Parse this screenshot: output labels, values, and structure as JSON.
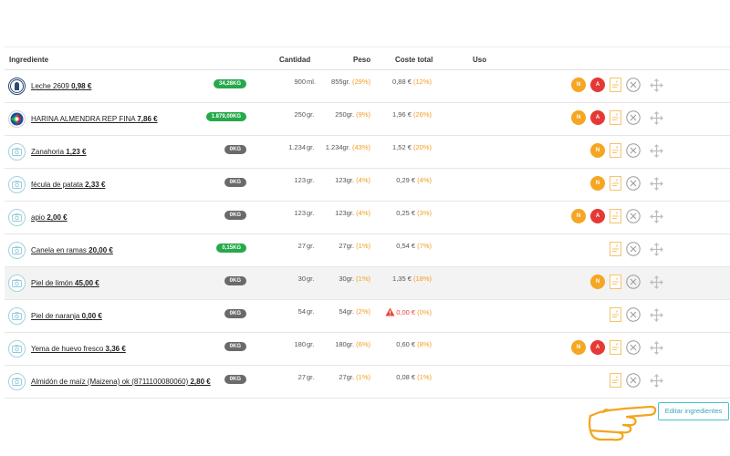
{
  "headers": {
    "ingrediente": "Ingrediente",
    "cantidad": "Cantidad",
    "peso": "Peso",
    "coste_total": "Coste total",
    "uso": "Uso"
  },
  "rows": [
    {
      "name": "Leche 2609",
      "price": "0,98 €",
      "badge": "34,28KG",
      "badge_color": "green",
      "qty": "900",
      "unit": "ml.",
      "peso": "855gr.",
      "peso_pct": "(29%)",
      "coste": "0,88 €",
      "coste_pct": "(12%)",
      "avatar": "logo",
      "flags": [
        "N",
        "A"
      ],
      "highlight": false,
      "warning": false
    },
    {
      "name": "HARINA ALMENDRA REP FINA",
      "price": "7,86 €",
      "badge": "1.879,00KG",
      "badge_color": "green",
      "qty": "250",
      "unit": "gr.",
      "peso": "250gr.",
      "peso_pct": "(9%)",
      "coste": "1,96 €",
      "coste_pct": "(26%)",
      "avatar": "logo",
      "flags": [
        "N",
        "A"
      ],
      "highlight": false,
      "warning": false
    },
    {
      "name": "Zanahoria",
      "price": "1,23 €",
      "badge": "0KG",
      "badge_color": "grey",
      "qty": "1.234",
      "unit": "gr.",
      "peso": "1.234gr.",
      "peso_pct": "(43%)",
      "coste": "1,52 €",
      "coste_pct": "(20%)",
      "avatar": "camera",
      "flags": [
        "N"
      ],
      "highlight": false,
      "warning": false
    },
    {
      "name": "fécula de patata",
      "price": "2,33 €",
      "badge": "0KG",
      "badge_color": "grey",
      "qty": "123",
      "unit": "gr.",
      "peso": "123gr.",
      "peso_pct": "(4%)",
      "coste": "0,29 €",
      "coste_pct": "(4%)",
      "avatar": "camera",
      "flags": [
        "N"
      ],
      "highlight": false,
      "warning": false
    },
    {
      "name": "apio",
      "price": "2,00 €",
      "badge": "0KG",
      "badge_color": "grey",
      "qty": "123",
      "unit": "gr.",
      "peso": "123gr.",
      "peso_pct": "(4%)",
      "coste": "0,25 €",
      "coste_pct": "(3%)",
      "avatar": "camera",
      "flags": [
        "N",
        "A"
      ],
      "highlight": false,
      "warning": false
    },
    {
      "name": "Canela en ramas",
      "price": "20,00 €",
      "badge": "0,15KG",
      "badge_color": "green",
      "qty": "27",
      "unit": "gr.",
      "peso": "27gr.",
      "peso_pct": "(1%)",
      "coste": "0,54 €",
      "coste_pct": "(7%)",
      "avatar": "camera",
      "flags": [],
      "highlight": false,
      "warning": false
    },
    {
      "name": "Piel de limón",
      "price": "45,00 €",
      "badge": "0KG",
      "badge_color": "grey",
      "qty": "30",
      "unit": "gr.",
      "peso": "30gr.",
      "peso_pct": "(1%)",
      "coste": "1,35 €",
      "coste_pct": "(18%)",
      "avatar": "camera",
      "flags": [
        "N"
      ],
      "highlight": true,
      "warning": false
    },
    {
      "name": "Piel de naranja",
      "price": "0,00 €",
      "badge": "0KG",
      "badge_color": "grey",
      "qty": "54",
      "unit": "gr.",
      "peso": "54gr.",
      "peso_pct": "(2%)",
      "coste": "0,00 €",
      "coste_pct": "(0%)",
      "avatar": "camera",
      "flags": [],
      "highlight": false,
      "warning": true
    },
    {
      "name": "Yema de huevo fresco",
      "price": "3,36 €",
      "badge": "0KG",
      "badge_color": "grey",
      "qty": "180",
      "unit": "gr.",
      "peso": "180gr.",
      "peso_pct": "(6%)",
      "coste": "0,60 €",
      "coste_pct": "(8%)",
      "avatar": "camera",
      "flags": [
        "N",
        "A"
      ],
      "highlight": false,
      "warning": false
    },
    {
      "name": "Almidón de maíz (Maizena) ok (8711100080060)",
      "price": "2,80 €",
      "badge": "0KG",
      "badge_color": "grey",
      "qty": "27",
      "unit": "gr.",
      "peso": "27gr.",
      "peso_pct": "(1%)",
      "coste": "0,08 €",
      "coste_pct": "(1%)",
      "avatar": "camera",
      "flags": [],
      "highlight": false,
      "warning": false
    }
  ],
  "edit_button": "Editar ingredientes",
  "colors": {
    "accent": "#45c2d6",
    "badge_green": "#26a94a",
    "badge_grey": "#6a6a6a",
    "flag_n": "#f5a623",
    "flag_a": "#e53935",
    "percent": "#f29b1d",
    "warning": "#e8443a"
  },
  "icons": {
    "avatar_placeholder": "camera-icon",
    "document": "document-icon",
    "remove": "close-circle-icon",
    "reorder": "move-icon",
    "pointer": "pointing-hand-icon",
    "warning": "warning-triangle-icon"
  }
}
